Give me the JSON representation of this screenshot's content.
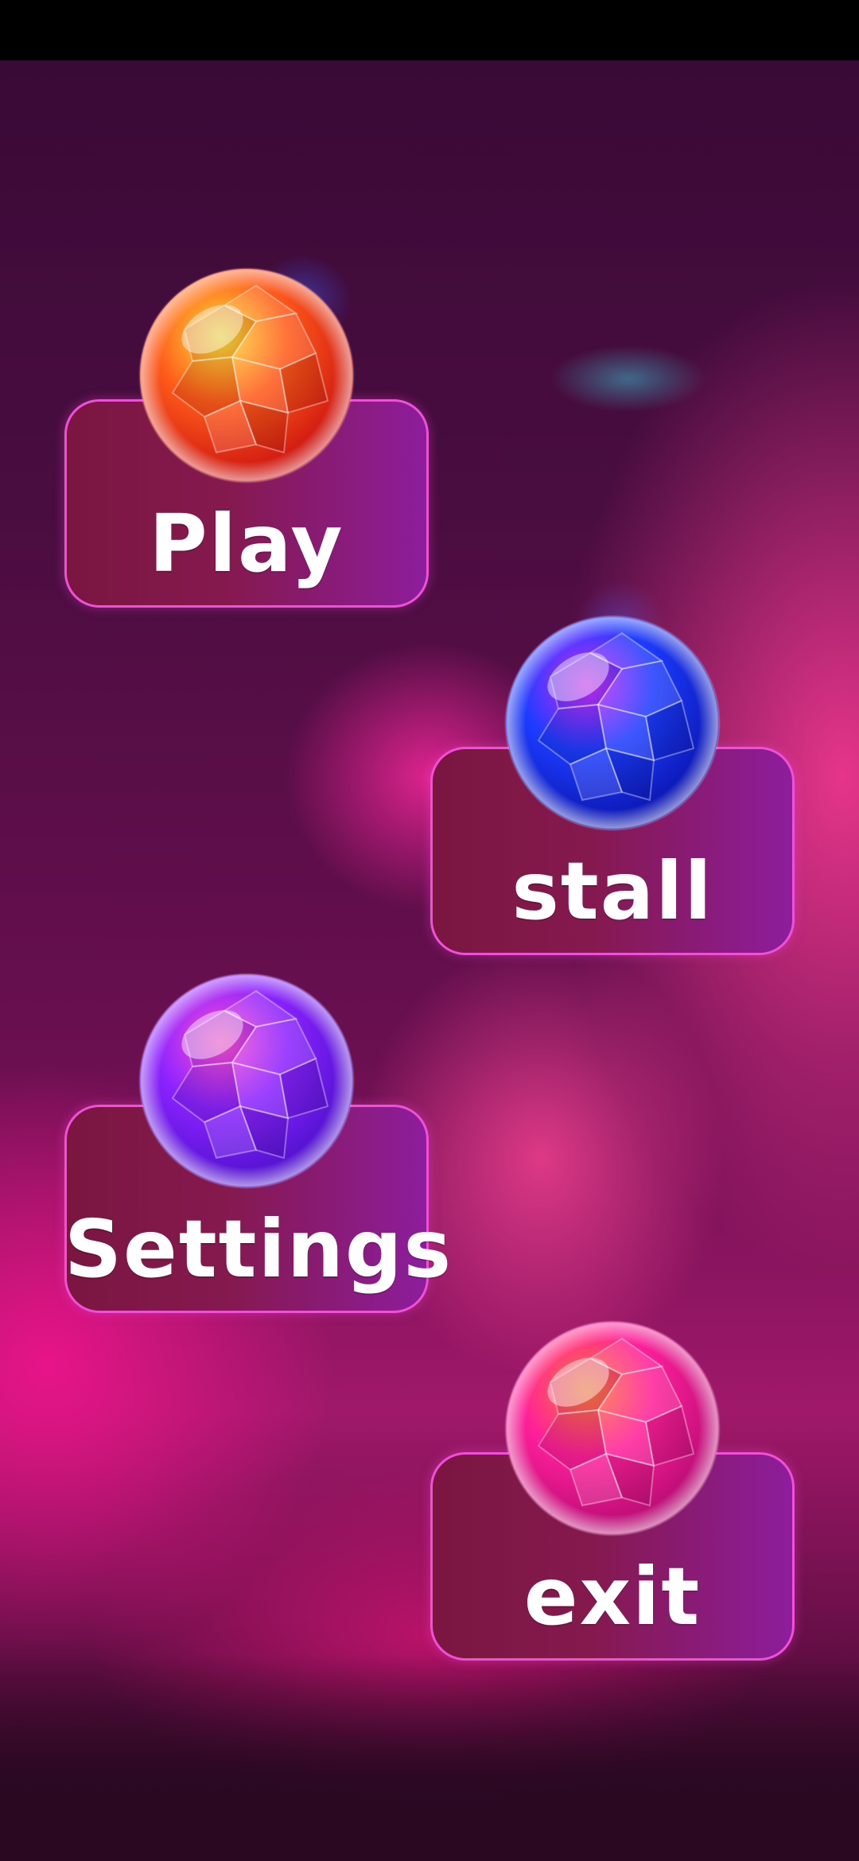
{
  "menu": {
    "items": [
      {
        "label": "Play",
        "orb_color": "#ff5a1a",
        "orb_highlight": "#ffe23a",
        "orb_shadow": "#c80f10"
      },
      {
        "label": "stall",
        "orb_color": "#1c3cff",
        "orb_highlight": "#d02cff",
        "orb_shadow": "#0a12a8"
      },
      {
        "label": "Settings",
        "orb_color": "#8a22ff",
        "orb_highlight": "#ff4fd8",
        "orb_shadow": "#4a10c8"
      },
      {
        "label": "exit",
        "orb_color": "#ff1f9a",
        "orb_highlight": "#ff7a3a",
        "orb_shadow": "#b00a70"
      }
    ]
  },
  "colors": {
    "panel_border": "#f04fd8",
    "panel_left": "#7a1640",
    "panel_right": "#8d1d9c",
    "label": "#ffffff"
  },
  "icons": [
    "gem-orb-icon"
  ]
}
